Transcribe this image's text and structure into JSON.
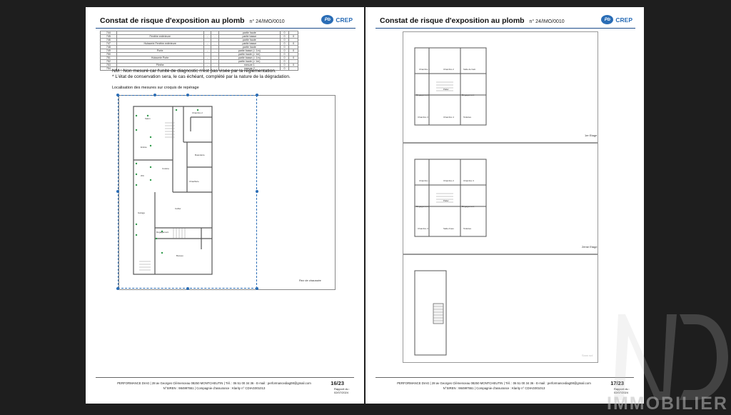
{
  "document": {
    "title": "Constat de risque d'exposition au plomb",
    "number": "n° 24/IMO/0010"
  },
  "logo": {
    "pb": "Pb",
    "crep": "CREP"
  },
  "measures_table": {
    "rows": [
      [
        "744",
        "",
        "",
        "",
        "partie haute",
        "0",
        ""
      ],
      [
        "745",
        "Fenêtre extérieure",
        "-",
        "-",
        "partie basse",
        "0",
        "0"
      ],
      [
        "746",
        "",
        "",
        "",
        "partie haute",
        "0",
        ""
      ],
      [
        "747",
        "Huisserie Fenêtre extérieure",
        "-",
        "-",
        "partie basse",
        "0",
        "0"
      ],
      [
        "748",
        "",
        "",
        "",
        "partie haute",
        "0",
        ""
      ],
      [
        "749",
        "Porte",
        "-",
        "-",
        "partie basse (< 1m)",
        "0",
        "0"
      ],
      [
        "750",
        "",
        "",
        "",
        "partie haute (> 1m)",
        "0",
        ""
      ],
      [
        "751",
        "Huisserie Porte",
        "-",
        "-",
        "partie basse (< 1m)",
        "0",
        "0"
      ],
      [
        "752",
        "",
        "",
        "",
        "partie haute (> 1m)",
        "0",
        ""
      ],
      [
        "753",
        "Plinthe",
        "-",
        "-",
        "mesure 1",
        "0",
        "0"
      ],
      [
        "754",
        "",
        "",
        "",
        "mesure 2",
        "0",
        ""
      ]
    ]
  },
  "notes": {
    "nm": "NM : Non mesuré car l'unité de diagnostic n'est pas visée par la réglementation.",
    "star": "* L'état de conservation sera, le cas échéant, complété par la nature de la dégradation."
  },
  "localisation_label": "Localisation des mesures sur croquis de repérage",
  "plans": {
    "ground": "Rez de chaussée",
    "floor1": "1er Etage",
    "floor2": "2ème Etage",
    "floor3": "Sous sol"
  },
  "room_labels": {
    "salon": "Salon",
    "cuisine": "Cuisine",
    "wc": "WC",
    "garage": "Garage",
    "chambre1": "Chambre 1",
    "chambre2": "Chambre 2",
    "chambre3": "Chambre 3",
    "chambre4": "Chambre 4",
    "sdb": "Salle de bain",
    "degagement": "Dégagement",
    "bureau": "Bureau",
    "cellier": "Cellier",
    "entree": "Entrée",
    "chaufferie": "Chaufferie",
    "buanderie": "Buanderie",
    "salle_eau": "Salle d'eau",
    "toilettes": "Toilettes",
    "palier": "Palier"
  },
  "footer": {
    "line1": "PERFORMANCE DIAG | 28 av Georges Clémenceau 08250 MONTCHEUTIN | Tél. : 06 51 00 34 36 - E-mail : performancediag08@gmail.com",
    "line2": "N°SIREN : 984997551 | Compagnie d'assurance : Klarity n° CDIAG001013",
    "report_label": "Rapport du :",
    "report_date": "02/07/2024",
    "left_page": "16/23",
    "right_page": "17/23"
  },
  "watermark": "IMMOBILIER",
  "colors": {
    "brand_blue": "#2a6db6",
    "background": "#1e1e1e",
    "paper": "#ffffff"
  }
}
